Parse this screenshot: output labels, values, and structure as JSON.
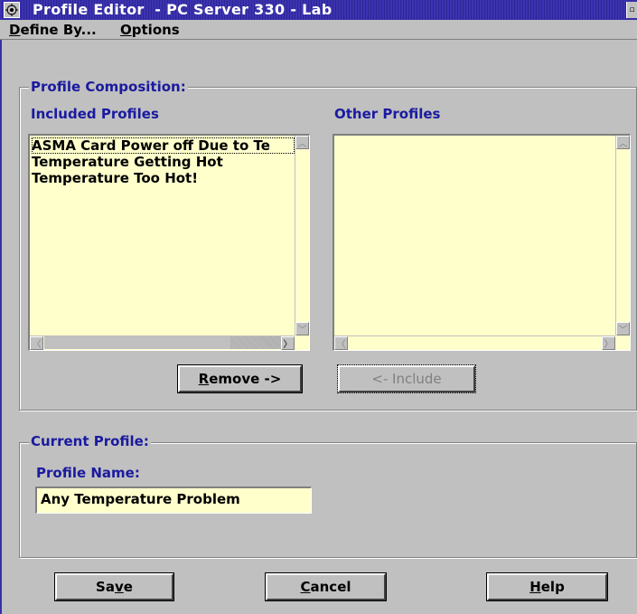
{
  "window": {
    "title": "Profile Editor  - PC Server 330 - Lab"
  },
  "menu": [
    {
      "label": "Define By..."
    },
    {
      "label": "Options"
    }
  ],
  "composition": {
    "group_label": "Profile Composition:",
    "included_label": "Included Profiles",
    "other_label": "Other Profiles",
    "included_items": [
      "ASMA Card Power off Due to Te",
      "Temperature Getting Hot",
      "Temperature Too Hot!"
    ],
    "other_items": [],
    "remove_button": "Remove ->",
    "include_button": "<- Include"
  },
  "current": {
    "group_label": "Current Profile:",
    "name_label": "Profile Name:",
    "name_value": "Any Temperature Problem"
  },
  "buttons": {
    "save": "Save",
    "cancel": "Cancel",
    "help": "Help"
  },
  "colors": {
    "titlebar": "#3a2fa8",
    "list_background": "#ffffcc",
    "label_blue": "#1a1aa0",
    "window_gray": "#c0c0c0"
  }
}
